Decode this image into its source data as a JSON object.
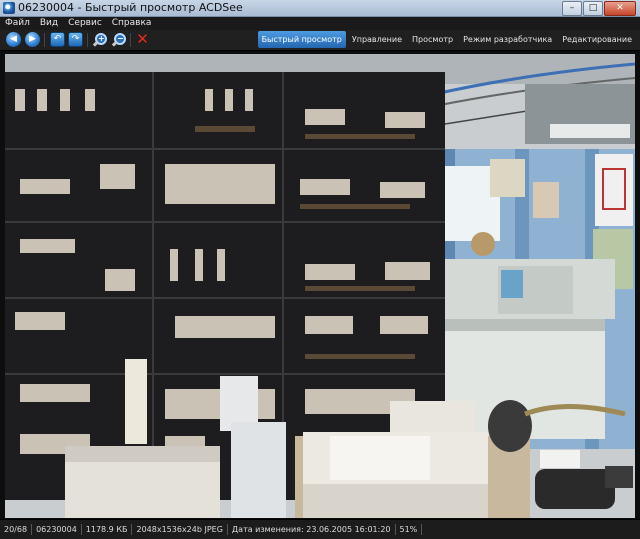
{
  "window": {
    "title": "06230004 - Быстрый просмотр ACDSee",
    "buttons": {
      "minimize": "–",
      "maximize": "□",
      "close": "✕"
    }
  },
  "menu": {
    "items": [
      "Файл",
      "Вид",
      "Сервис",
      "Справка"
    ]
  },
  "toolbar": {
    "buttons": [
      {
        "name": "prev-button",
        "icon": "arrow-left-icon",
        "glyph": "◀"
      },
      {
        "name": "next-button",
        "icon": "arrow-right-icon",
        "glyph": "▶"
      },
      {
        "name": "rotate-left-button",
        "icon": "rotate-left-icon",
        "glyph": "↶"
      },
      {
        "name": "rotate-right-button",
        "icon": "rotate-right-icon",
        "glyph": "↷"
      },
      {
        "name": "zoom-in-button",
        "icon": "zoom-in-icon",
        "glyph": "+"
      },
      {
        "name": "zoom-out-button",
        "icon": "zoom-out-icon",
        "glyph": "−"
      },
      {
        "name": "delete-button",
        "icon": "delete-x-icon",
        "glyph": "✕"
      }
    ],
    "tabs": [
      {
        "label": "Быстрый просмотр",
        "active": true
      },
      {
        "label": "Управление",
        "active": false
      },
      {
        "label": "Просмотр",
        "active": false
      },
      {
        "label": "Режим разработчика",
        "active": false
      },
      {
        "label": "Редактирование",
        "active": false
      }
    ],
    "accent": "#2f78c6"
  },
  "image": {
    "subject": "photo-of-electrical-control-panel-room"
  },
  "status": {
    "position": "20/68",
    "filename": "06230004",
    "filesize": "1178.9 КБ",
    "dimensions": "2048x1536x24b JPEG",
    "modified": "Дата изменения: 23.06.2005 16:01:20",
    "zoom": "51%"
  }
}
